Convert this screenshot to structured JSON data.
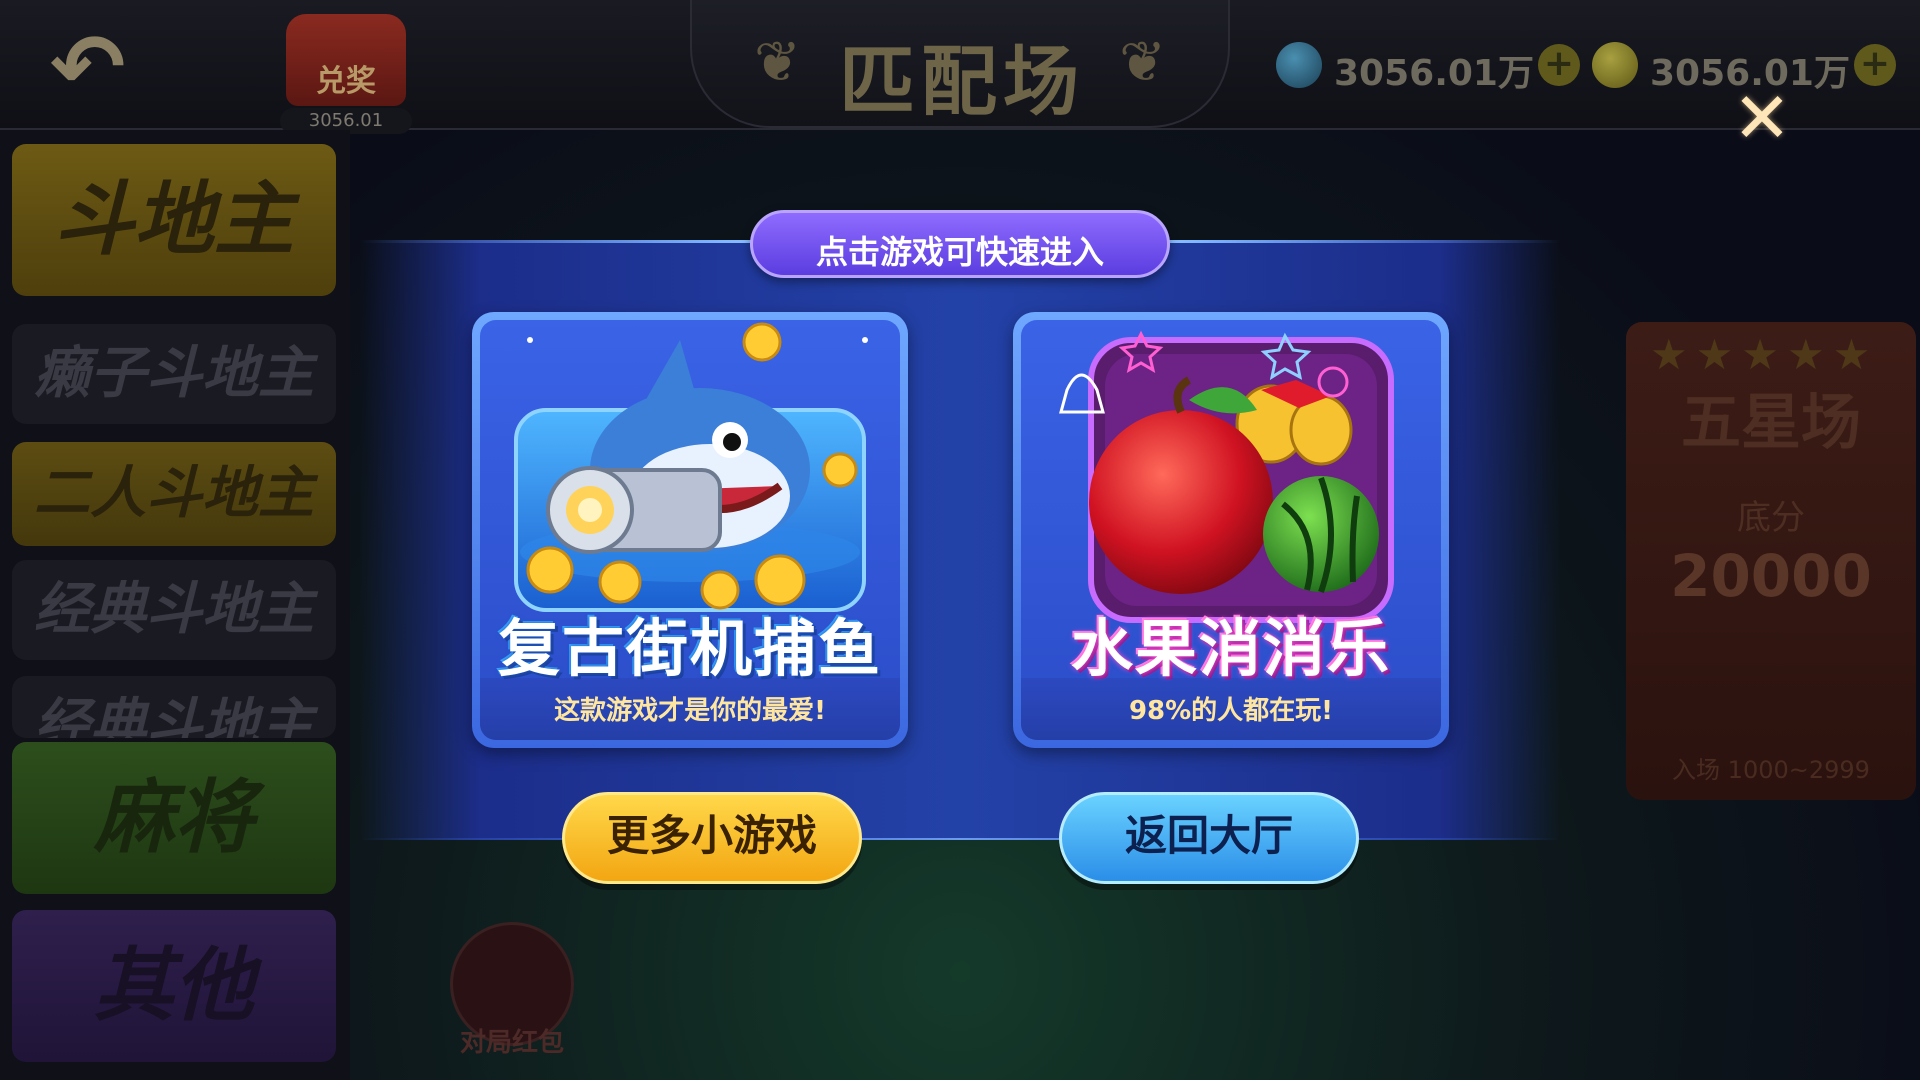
{
  "header": {
    "title": "匹配场",
    "redeem": {
      "label": "兑奖",
      "amount": "3056.01"
    },
    "currency": [
      {
        "icon": "diamond-icon",
        "value": "3056.01万"
      },
      {
        "icon": "gold-coin-icon",
        "value": "3056.01万"
      }
    ]
  },
  "sidebar": {
    "items": [
      {
        "label": "斗地主"
      },
      {
        "label": "癞子斗地主"
      },
      {
        "label": "二人斗地主"
      },
      {
        "label": "经典斗地主"
      },
      {
        "label": "经典斗地主"
      },
      {
        "label": "麻将"
      },
      {
        "label": "其他"
      }
    ]
  },
  "room": {
    "title": "五星场",
    "base_label": "底分",
    "base_value": "20000",
    "entry": "入场 1000~2999"
  },
  "redpack": {
    "label": "对局红包"
  },
  "modal": {
    "hint": "点击游戏可快速进入",
    "games": [
      {
        "title": "复古街机捕鱼",
        "subtitle": "这款游戏才是你的最爱!"
      },
      {
        "title": "水果消消乐",
        "subtitle": "98%的人都在玩!"
      }
    ],
    "more_button": "更多小游戏",
    "back_button": "返回大厅"
  }
}
